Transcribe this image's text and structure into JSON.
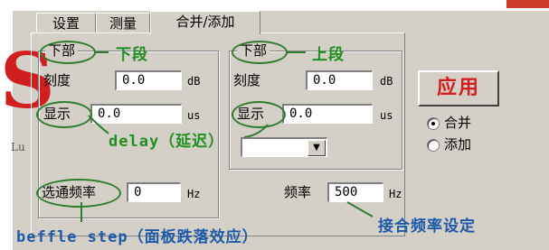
{
  "tabs": [
    {
      "label": "设置"
    },
    {
      "label": "测量"
    },
    {
      "label": "合并/添加"
    }
  ],
  "lower": {
    "group_title": "下部",
    "scale_label": "刻度",
    "scale_value": "0.0",
    "scale_unit": "dB",
    "display_label": "显示",
    "display_value": "0.0",
    "display_unit": "us"
  },
  "upper": {
    "group_title": "下部",
    "scale_label": "刻度",
    "scale_value": "0.0",
    "scale_unit": "dB",
    "display_label": "显示",
    "display_value": "0.0",
    "display_unit": "us",
    "dropdown_value": ""
  },
  "passband": {
    "label": "选通频率",
    "value": "0",
    "unit": "Hz"
  },
  "frequency": {
    "label": "频率",
    "value": "500",
    "unit": "Hz"
  },
  "apply_button": "应用",
  "mode": {
    "options": [
      "合并",
      "添加"
    ],
    "selected": "合并"
  },
  "background": {
    "big_letter": "S",
    "small_text": "Lu"
  },
  "annotations": {
    "lower_segment": "下段",
    "upper_segment": "上段",
    "delay": "delay（延迟）",
    "baffle_step": "beffle step（面板跌落效应）",
    "crossover": "接合频率设定"
  }
}
